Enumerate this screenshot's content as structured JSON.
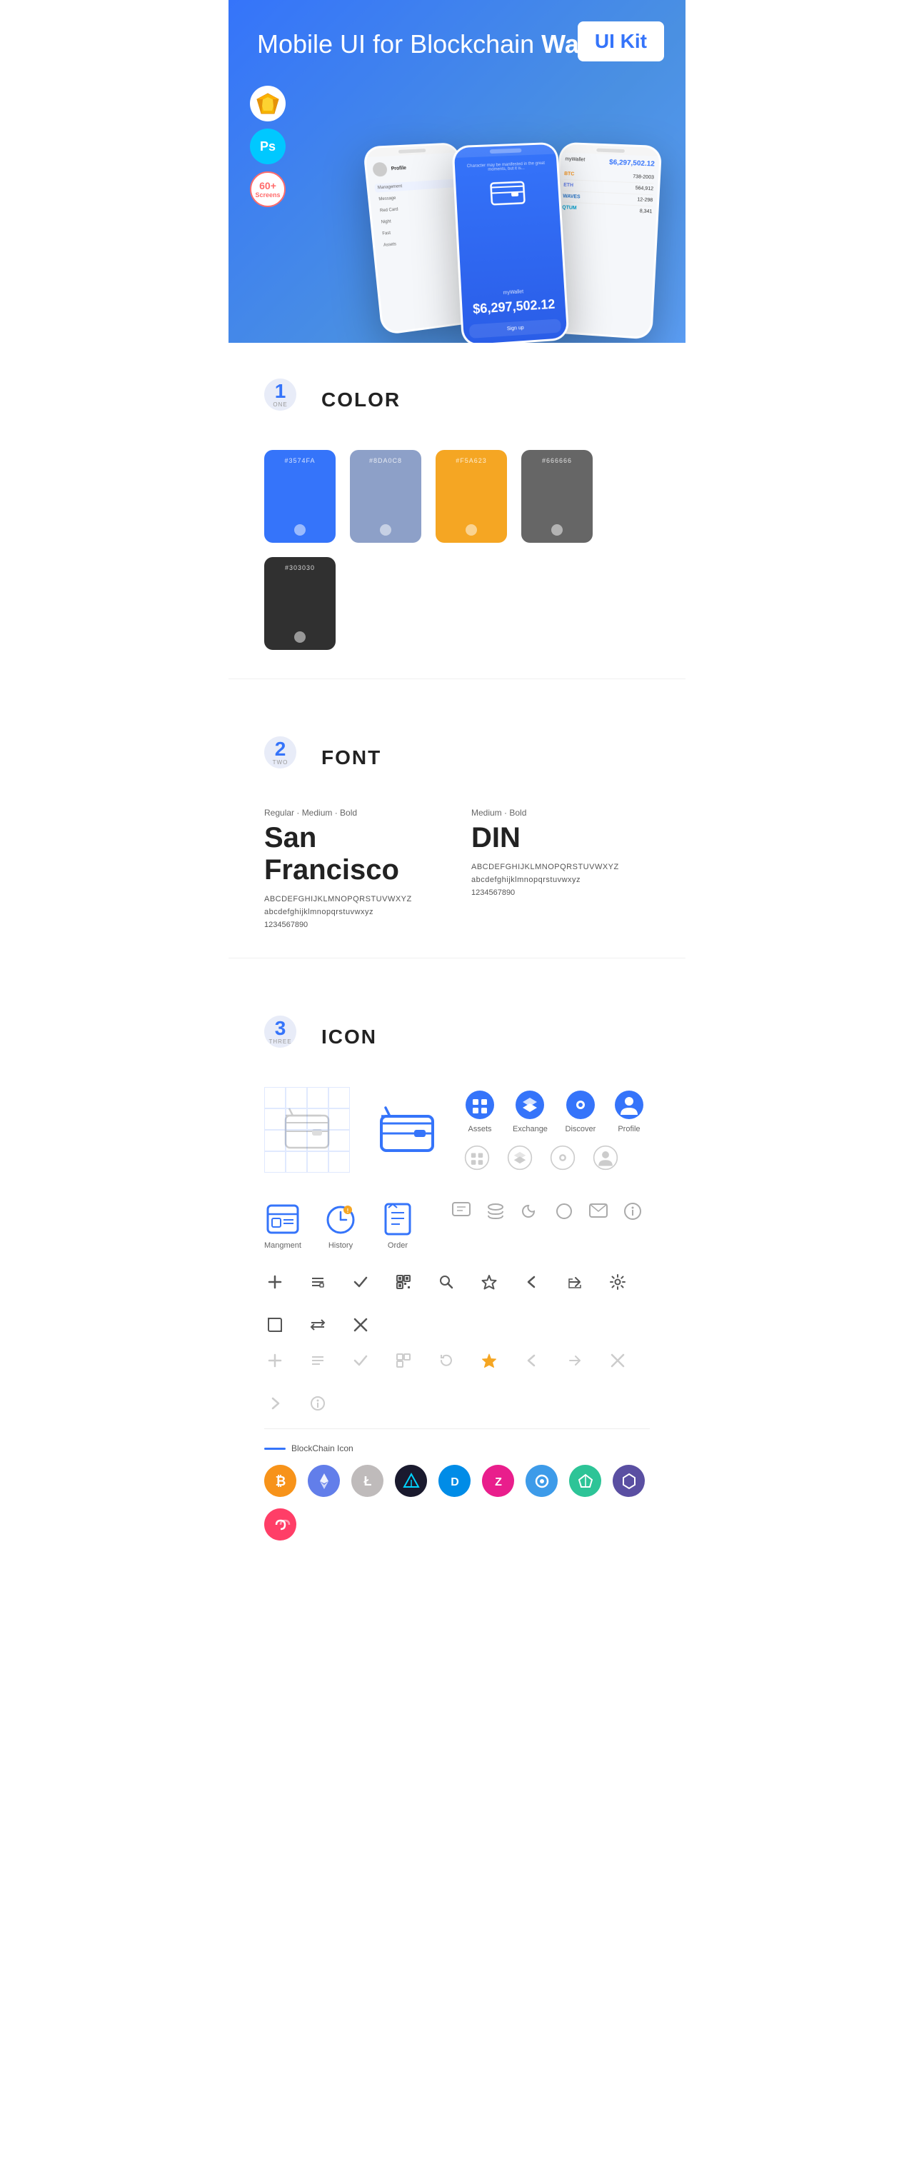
{
  "hero": {
    "title_normal": "Mobile UI for Blockchain ",
    "title_bold": "Wallet",
    "badge": "UI Kit",
    "badges": {
      "sketch": "Sketch",
      "ps": "Ps",
      "screens": "60+\nScreens"
    }
  },
  "sections": {
    "color": {
      "number": "1",
      "number_label": "ONE",
      "title": "COLOR",
      "swatches": [
        {
          "hex": "#3574FA",
          "label": "#3574FA"
        },
        {
          "hex": "#8DA0C8",
          "label": "#8DA0C8"
        },
        {
          "hex": "#F5A623",
          "label": "#F5A623"
        },
        {
          "hex": "#666666",
          "label": "#666666"
        },
        {
          "hex": "#303030",
          "label": "#303030"
        }
      ]
    },
    "font": {
      "number": "2",
      "number_label": "TWO",
      "title": "FONT",
      "fonts": [
        {
          "style": "Regular · Medium · Bold",
          "name": "San Francisco",
          "uppercase": "ABCDEFGHIJKLMNOPQRSTUVWXYZ",
          "lowercase": "abcdefghijklmnopqrstuvwxyz",
          "numbers": "1234567890"
        },
        {
          "style": "Medium · Bold",
          "name": "DIN",
          "uppercase": "ABCDEFGHIJKLMNOPQRSTUVWXYZ",
          "lowercase": "abcdefghijklmnopqrstuvwxyz",
          "numbers": "1234567890"
        }
      ]
    },
    "icon": {
      "number": "3",
      "number_label": "THREE",
      "title": "ICON",
      "nav_icons": [
        {
          "label": "Assets"
        },
        {
          "label": "Exchange"
        },
        {
          "label": "Discover"
        },
        {
          "label": "Profile"
        }
      ],
      "bottom_icons": [
        {
          "label": "Mangment"
        },
        {
          "label": "History"
        },
        {
          "label": "Order"
        }
      ],
      "blockchain_label": "BlockChain Icon",
      "cryptos": [
        {
          "color": "#F7931A",
          "symbol": "₿",
          "name": "Bitcoin"
        },
        {
          "color": "#627EEA",
          "symbol": "♦",
          "name": "Ethereum"
        },
        {
          "color": "#B59A2E",
          "symbol": "Ł",
          "name": "Litecoin"
        },
        {
          "color": "#1A1A2E",
          "symbol": "◆",
          "name": "Verge"
        },
        {
          "color": "#008CE7",
          "symbol": "D",
          "name": "Dash"
        },
        {
          "color": "#E91E8C",
          "symbol": "Z",
          "name": "Zcoin"
        },
        {
          "color": "#3D9BE9",
          "symbol": "◉",
          "name": "Doge"
        },
        {
          "color": "#2DC497",
          "symbol": "▲",
          "name": "Tron"
        },
        {
          "color": "#5A4FA2",
          "symbol": "◆",
          "name": "Token"
        },
        {
          "color": "#FF3E67",
          "symbol": "∞",
          "name": "Other"
        }
      ]
    }
  }
}
